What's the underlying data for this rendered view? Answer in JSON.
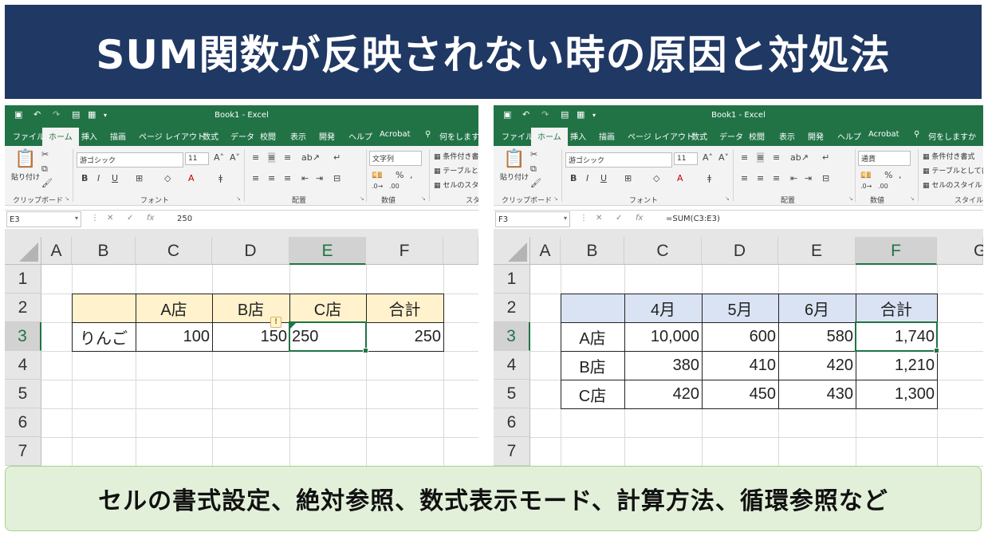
{
  "banner": {
    "title": "SUM関数が反映されない時の原因と対処法"
  },
  "footer": {
    "text": "セルの書式設定、絶対参照、数式表示モード、計算方法、循環参照など"
  },
  "left": {
    "title": "Book1 - Excel",
    "tabs": [
      "ファイル",
      "ホーム",
      "挿入",
      "描画",
      "ページ レイアウト",
      "数式",
      "データ",
      "校閲",
      "表示",
      "開発",
      "ヘルプ",
      "Acrobat",
      "何をしますか"
    ],
    "ribbon": {
      "paste": "貼り付け",
      "font": "游ゴシック",
      "size": "11",
      "format": "文字列",
      "cond": "条件付き書",
      "table": "テーブルとし",
      "cellstyle": "セルのスタイ",
      "groups": [
        "クリップボード",
        "フォント",
        "配置",
        "数値",
        "スタ"
      ]
    },
    "namebox": "E3",
    "formula": "250",
    "cols": [
      "A",
      "B",
      "C",
      "D",
      "E",
      "F"
    ],
    "rows": [
      "1",
      "2",
      "3",
      "4",
      "5",
      "6",
      "7"
    ],
    "cells": {
      "c2": "A店",
      "d2": "B店",
      "e2": "C店",
      "f2": "合計",
      "b3": "りんご",
      "c3": "100",
      "d3": "150",
      "e3": "250",
      "f3": "250"
    }
  },
  "right": {
    "title": "Book1 - Excel",
    "tabs": [
      "ファイル",
      "ホーム",
      "挿入",
      "描画",
      "ページ レイアウト",
      "数式",
      "データ",
      "校閲",
      "表示",
      "開発",
      "ヘルプ",
      "Acrobat",
      "何をしますか"
    ],
    "ribbon": {
      "paste": "貼り付け",
      "font": "游ゴシック",
      "size": "11",
      "format": "通貨",
      "cond": "条件付き書式",
      "table": "テーブルとして書",
      "cellstyle": "セルのスタイル",
      "groups": [
        "クリップボード",
        "フォント",
        "配置",
        "数値",
        "スタイル"
      ]
    },
    "namebox": "F3",
    "formula": "=SUM(C3:E3)",
    "cols": [
      "A",
      "B",
      "C",
      "D",
      "E",
      "F",
      "G"
    ],
    "rows": [
      "1",
      "2",
      "3",
      "4",
      "5",
      "6",
      "7"
    ],
    "cells": {
      "c2": "4月",
      "d2": "5月",
      "e2": "6月",
      "f2": "合計",
      "b3": "A店",
      "c3": "10,000",
      "d3": "600",
      "e3": "580",
      "f3": "1,740",
      "b4": "B店",
      "c4": "380",
      "d4": "410",
      "e4": "420",
      "f4": "1,210",
      "b5": "C店",
      "c5": "420",
      "d5": "450",
      "e5": "430",
      "f5": "1,300"
    }
  },
  "colors": {
    "banner": "#203864",
    "excel_green": "#217346",
    "header_fill": "#fff2cc",
    "header_fill_blue": "#dae3f3",
    "footer_bg": "#e2f0d9"
  }
}
